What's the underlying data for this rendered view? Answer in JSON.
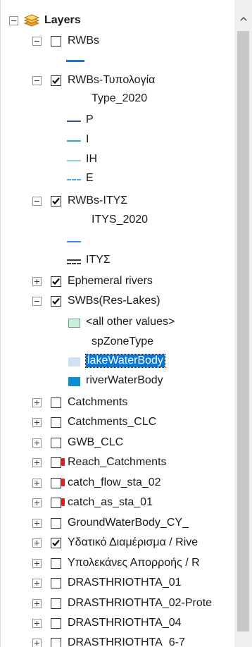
{
  "root": {
    "title": "Layers"
  },
  "layers": [
    {
      "name": "RWBs",
      "checked": false,
      "expanded": true
    },
    {
      "name": "RWBs-Τυπολογία",
      "checked": true,
      "expanded": true,
      "field": "Type_2020",
      "classes": [
        "P",
        "I",
        "IH",
        "E"
      ]
    },
    {
      "name": "RWBs-ΙΤΥΣ",
      "checked": true,
      "expanded": true,
      "field": "ITYS_2020",
      "classes": [
        "ΙΤΥΣ"
      ]
    },
    {
      "name": "Ephemeral rivers",
      "checked": true,
      "expanded": false
    },
    {
      "name": "SWBs(Res-Lakes)",
      "checked": true,
      "expanded": true,
      "field": "spZoneType",
      "classes": [
        "<all other values>",
        "lakeWaterBody",
        "riverWaterBody"
      ],
      "selected": "lakeWaterBody"
    },
    {
      "name": "Catchments",
      "checked": false,
      "expanded": false
    },
    {
      "name": "Catchments_CLC",
      "checked": false,
      "expanded": false
    },
    {
      "name": "GWB_CLC",
      "checked": false,
      "expanded": false
    },
    {
      "name": "Reach_Catchments",
      "checked": false,
      "expanded": false,
      "broken": true
    },
    {
      "name": "catch_flow_sta_02",
      "checked": false,
      "expanded": false,
      "broken": true
    },
    {
      "name": "catch_as_sta_01",
      "checked": false,
      "expanded": false,
      "broken": true
    },
    {
      "name": "GroundWaterBody_CY_",
      "checked": false,
      "expanded": false
    },
    {
      "name": "Υδατικό Διαμέρισμα / Rive",
      "checked": true,
      "expanded": false
    },
    {
      "name": "Υπολεκάνες Απορροής / R",
      "checked": false,
      "expanded": false
    },
    {
      "name": "DRASTHRIOTHTA_01",
      "checked": false,
      "expanded": false
    },
    {
      "name": "DRASTHRIOTHTA_02-Prote",
      "checked": false,
      "expanded": false
    },
    {
      "name": "DRASTHRIOTHTA_04",
      "checked": false,
      "expanded": false
    },
    {
      "name": "DRASTHRIOTHTA_6-7",
      "checked": false,
      "expanded": false
    }
  ],
  "colors": {
    "rwbs_line": "#1e6fe0",
    "class_P": "#2f4f8f",
    "class_I": "#3aa0d8",
    "class_IH": "#8fd0ee",
    "class_E": "#4fa8e0",
    "itys_line": "#3b8fe0",
    "all_other_fill": "#c9f0d8",
    "lake_fill": "#cfe2f3",
    "river_fill": "#0a8fd0",
    "selection": "#0b78d4"
  }
}
